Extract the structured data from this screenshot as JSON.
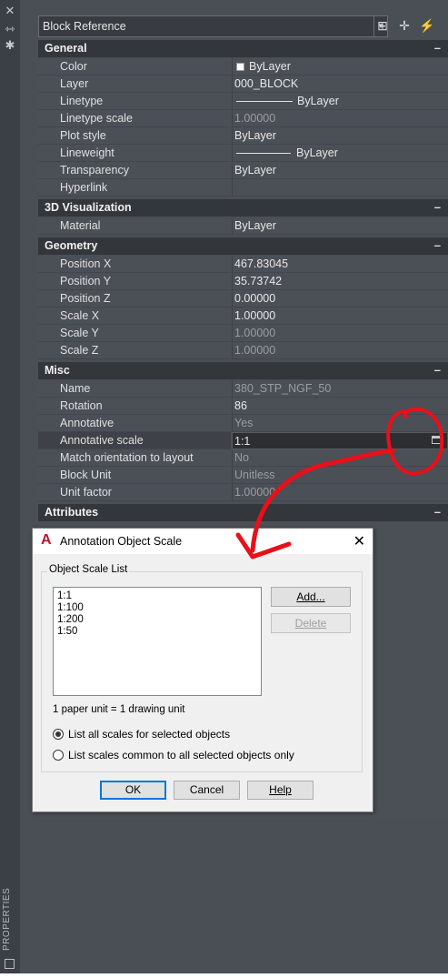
{
  "toolbar": {
    "object_type": "Block Reference",
    "icons": [
      "toggle-pickadd-icon",
      "select-objects-icon",
      "quick-select-icon"
    ]
  },
  "side_strip": {
    "label": "PROPERTIES",
    "icons": [
      "close-icon",
      "auto-hide-icon",
      "settings-icon",
      "properties-icon"
    ]
  },
  "sections": {
    "general": {
      "title": "General",
      "rows": [
        {
          "label": "Color",
          "value": "ByLayer"
        },
        {
          "label": "Layer",
          "value": "000_BLOCK"
        },
        {
          "label": "Linetype",
          "value": "ByLayer"
        },
        {
          "label": "Linetype scale",
          "value": "1.00000"
        },
        {
          "label": "Plot style",
          "value": "ByLayer"
        },
        {
          "label": "Lineweight",
          "value": "ByLayer"
        },
        {
          "label": "Transparency",
          "value": "ByLayer"
        },
        {
          "label": "Hyperlink",
          "value": ""
        }
      ]
    },
    "viz3d": {
      "title": "3D Visualization",
      "rows": [
        {
          "label": "Material",
          "value": "ByLayer"
        }
      ]
    },
    "geometry": {
      "title": "Geometry",
      "rows": [
        {
          "label": "Position X",
          "value": "467.83045"
        },
        {
          "label": "Position Y",
          "value": "35.73742"
        },
        {
          "label": "Position Z",
          "value": "0.00000"
        },
        {
          "label": "Scale X",
          "value": "1.00000"
        },
        {
          "label": "Scale Y",
          "value": "1.00000"
        },
        {
          "label": "Scale Z",
          "value": "1.00000"
        }
      ]
    },
    "misc": {
      "title": "Misc",
      "rows": [
        {
          "label": "Name",
          "value": "380_STP_NGF_50"
        },
        {
          "label": "Rotation",
          "value": "86"
        },
        {
          "label": "Annotative",
          "value": "Yes"
        },
        {
          "label": "Annotative scale",
          "value": "1:1"
        },
        {
          "label": "Match orientation to layout",
          "value": "No"
        },
        {
          "label": "Block Unit",
          "value": "Unitless"
        },
        {
          "label": "Unit factor",
          "value": "1.00000"
        }
      ]
    },
    "attributes": {
      "title": "Attributes"
    }
  },
  "dialog": {
    "title": "Annotation Object Scale",
    "group_label": "Object Scale List",
    "scales": [
      "1:1",
      "1:100",
      "1:200",
      "1:50"
    ],
    "add_label": "Add...",
    "delete_label": "Delete",
    "unit_note": "1 paper unit = 1 drawing unit",
    "radio_all": "List all scales for selected objects",
    "radio_common": "List scales common to all selected objects only",
    "selected_radio": "all",
    "ok_label": "OK",
    "cancel_label": "Cancel",
    "help_label": "Help"
  },
  "colors": {
    "panel_bg": "#4a4e55",
    "section_bg": "#33363b",
    "annotation_red": "#e8101a",
    "autocad_red": "#c8102e"
  }
}
